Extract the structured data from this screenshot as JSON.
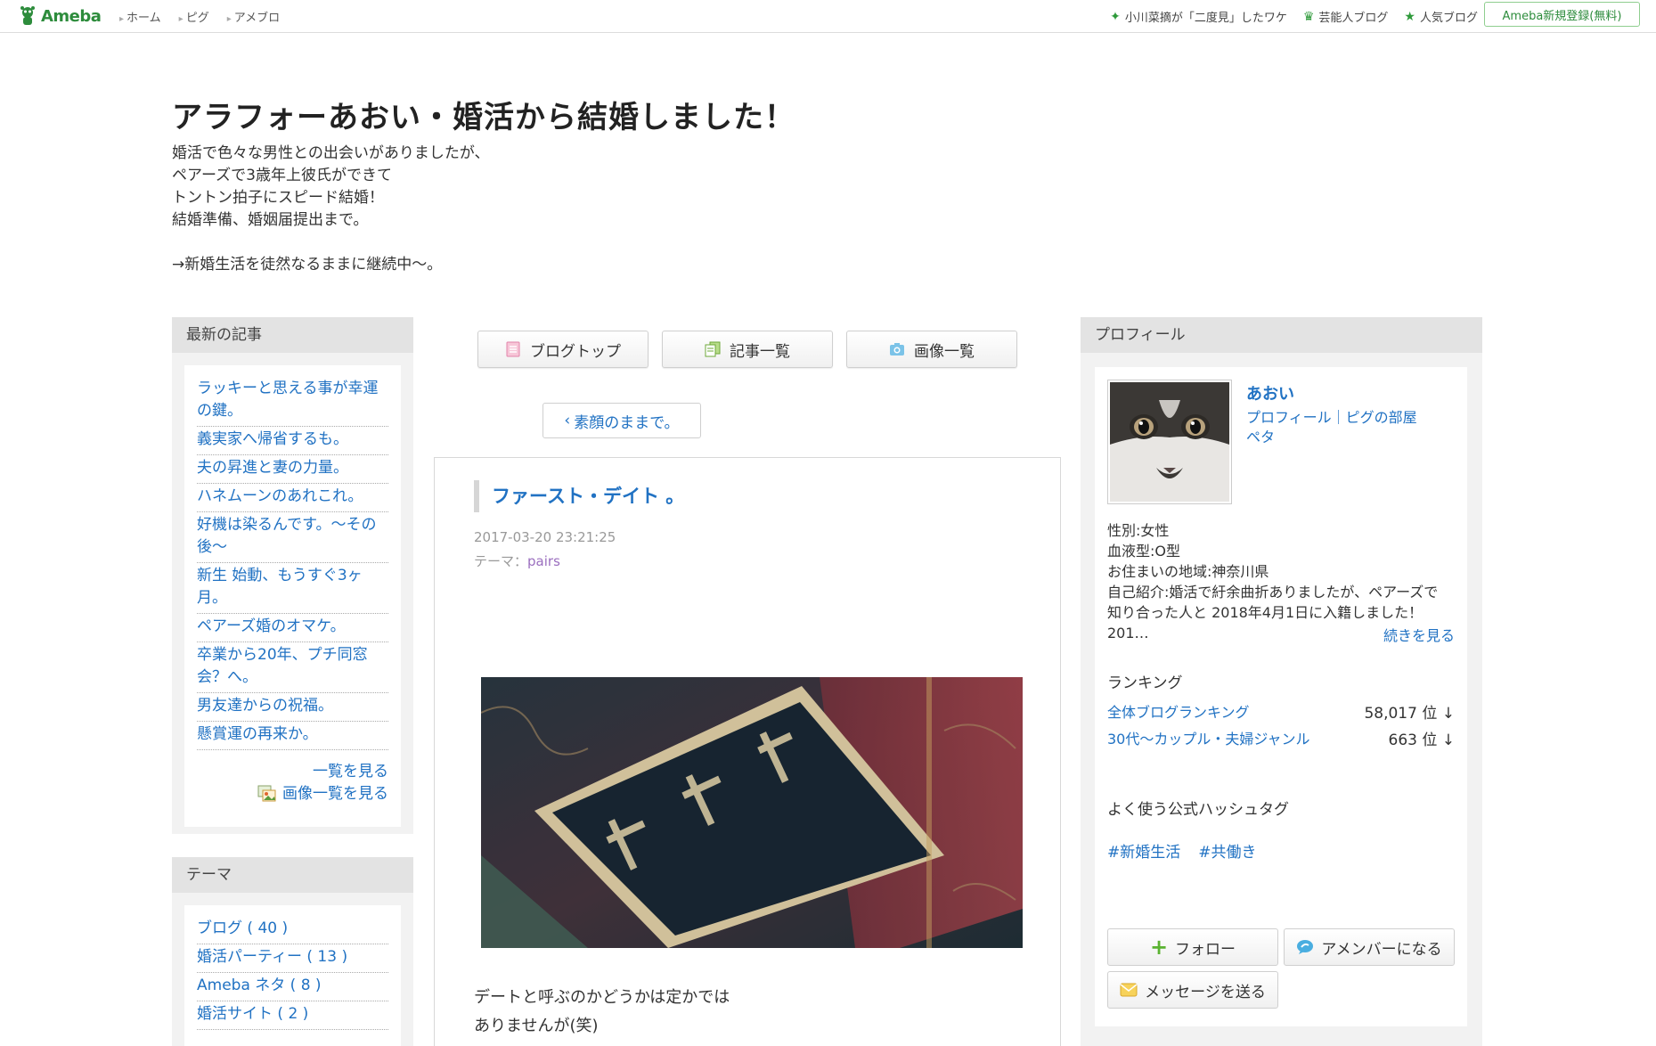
{
  "topbar": {
    "logo_text": "Ameba",
    "nav": [
      "ホーム",
      "ピグ",
      "アメブロ"
    ],
    "right_links": [
      "小川菜摘が「二度見」したワケ",
      "芸能人ブログ",
      "人気ブログ"
    ],
    "signup": "Ameba新規登録(無料)"
  },
  "header": {
    "title": "アラフォーあおい・婚活から結婚しました！",
    "desc": [
      "婚活で色々な男性との出会いがありましたが、",
      "ペアーズで3歳年上彼氏ができて",
      "トントン拍子にスピード結婚！",
      "結婚準備、婚姻届提出まで。",
      "",
      "→新婚生活を徒然なるままに継続中〜。"
    ]
  },
  "latest": {
    "heading": "最新の記事",
    "items": [
      "ラッキーと思える事が幸運の鍵。",
      "義実家へ帰省するも。",
      "夫の昇進と妻の力量。",
      "ハネムーンのあれこれ。",
      "好機は染るんです。〜その後〜",
      "新生 始動、もうすぐ3ヶ月。",
      "ペアーズ婚のオマケ。",
      "卒業から20年、プチ同窓会？へ。",
      "男友達からの祝福。",
      "懸賞運の再来か。"
    ],
    "see_all": "一覧を見る",
    "see_images": "画像一覧を見る"
  },
  "theme": {
    "heading": "テーマ",
    "items": [
      "ブログ ( 40 )",
      "婚活パーティー ( 13 )",
      "Ameba ネタ ( 8 )",
      "婚活サイト ( 2 )"
    ]
  },
  "center": {
    "btn_top": "ブログトップ",
    "btn_list": "記事一覧",
    "btn_images": "画像一覧",
    "prev": "素顔のままで。",
    "article_title": "ファースト・デイト 。",
    "date": "2017-03-20 23:21:25",
    "theme_label": "テーマ：",
    "theme_value": "pairs",
    "body": [
      "デートと呼ぶのかどうかは定かでは",
      "ありませんが(笑)"
    ]
  },
  "profile": {
    "heading": "プロフィール",
    "name": "あおい",
    "links": "プロフィール｜ピグの部屋",
    "peta": "ペタ",
    "gender": "性別:女性",
    "blood": "血液型:O型",
    "area": "お住まいの地域:神奈川県",
    "intro1": "自己紹介:婚活で紆余曲折ありましたが、ペアーズで",
    "intro2": "知り合った人と 2018年4月1日に入籍しました！ 201…",
    "readmore": "続きを見る",
    "ranking_heading": "ランキング",
    "rank1_label": "全体ブログランキング",
    "rank1_value": "58,017 位 ↓",
    "rank2_label": "30代〜カップル・夫婦ジャンル",
    "rank2_value": "663 位 ↓",
    "hashtag_heading": "よく使う公式ハッシュタグ",
    "hashtags": [
      "#新婚生活",
      "#共働き"
    ],
    "follow": "フォロー",
    "amember": "アメンバーになる",
    "message": "メッセージを送る"
  },
  "colors": {
    "link": "#2172c3",
    "ameba_green": "#2d8c3c",
    "box_bg": "#f2f2f2"
  }
}
